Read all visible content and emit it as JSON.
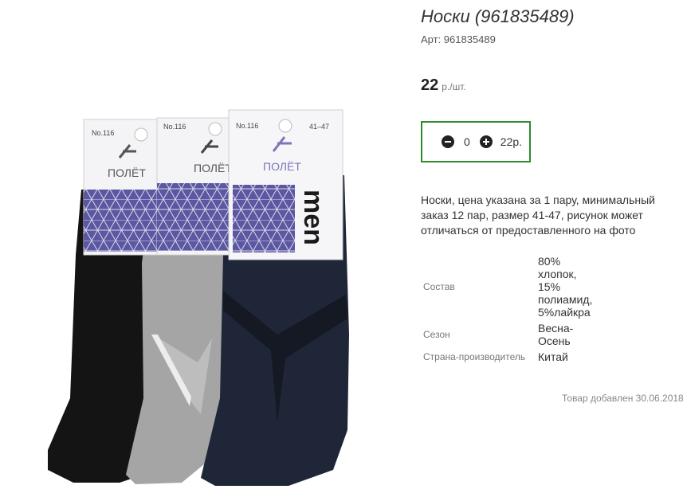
{
  "product": {
    "title": "Носки (961835489)",
    "sku": "Арт: 961835489",
    "price_value": "22",
    "price_unit": "р./шт.",
    "quantity": "0",
    "total": "22р.",
    "description": "Носки, цена указана за 1 пару, минимальный заказ 12 пар, размер 41-47, рисунок может отличаться от предоставленного на фото",
    "properties": [
      {
        "label": "Состав",
        "value": "80% хлопок, 15% полиамид, 5%лайкра"
      },
      {
        "label": "Сезон",
        "value": "Весна-Осень"
      },
      {
        "label": "Страна-производитель",
        "value": "Китай"
      }
    ],
    "added": "Товар добавлен 30.06.2018"
  },
  "image": {
    "tags": [
      {
        "model": "No.116",
        "brand": "ПОЛЁТ",
        "size": ""
      },
      {
        "model": "No.116",
        "brand": "ПОЛЁТ",
        "size": ""
      },
      {
        "model": "No.116",
        "brand": "ПОЛЁТ",
        "size": "41–47"
      }
    ],
    "side_text": "men",
    "colors": {
      "sock_black": "#141414",
      "sock_gray": "#a5a5a5",
      "sock_navy": "#1e2638",
      "pattern": "#5b57a0",
      "accent": "#2e8b2e"
    }
  }
}
